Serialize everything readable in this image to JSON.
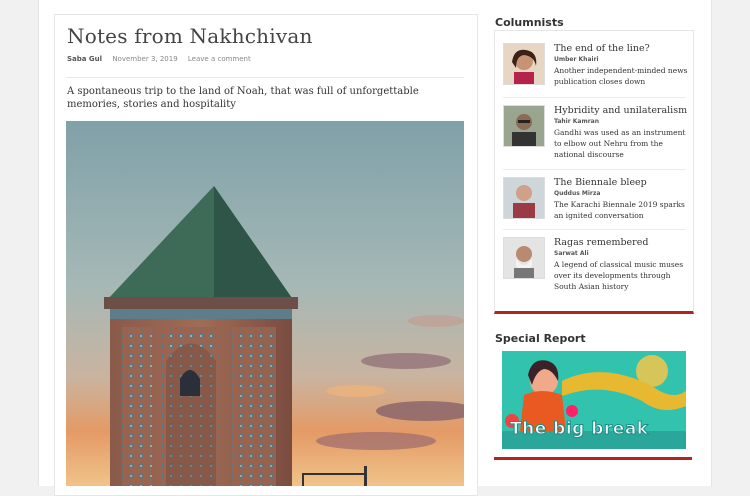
{
  "article": {
    "title": "Notes from Nakhchivan",
    "author": "Saba Gul",
    "date": "November 3, 2019",
    "comment_link": "Leave a comment",
    "subtitle": "A spontaneous trip to the land of Noah, that was full of unforgettable memories, stories and hospitality"
  },
  "sidebar": {
    "columnists_heading": "Columnists",
    "items": [
      {
        "title": "The end of the line?",
        "author": "Umber Khairi",
        "desc": "Another independent-minded news publication closes down"
      },
      {
        "title": "Hybridity and unilateralism",
        "author": "Tahir Kamran",
        "desc": "Gandhi was used as an instrument to elbow out Nehru from the national discourse"
      },
      {
        "title": "The Biennale bleep",
        "author": "Quddus Mirza",
        "desc": "The Karachi Biennale 2019 sparks an ignited conversation"
      },
      {
        "title": "Ragas remembered",
        "author": "Sarwat Ali",
        "desc": "A legend of classical music muses over its developments through South Asian history"
      }
    ],
    "special_heading": "Special Report",
    "special_banner": "The big break"
  },
  "colors": {
    "accent": "#b3241e",
    "banner_teal": "#1d8f8a"
  }
}
